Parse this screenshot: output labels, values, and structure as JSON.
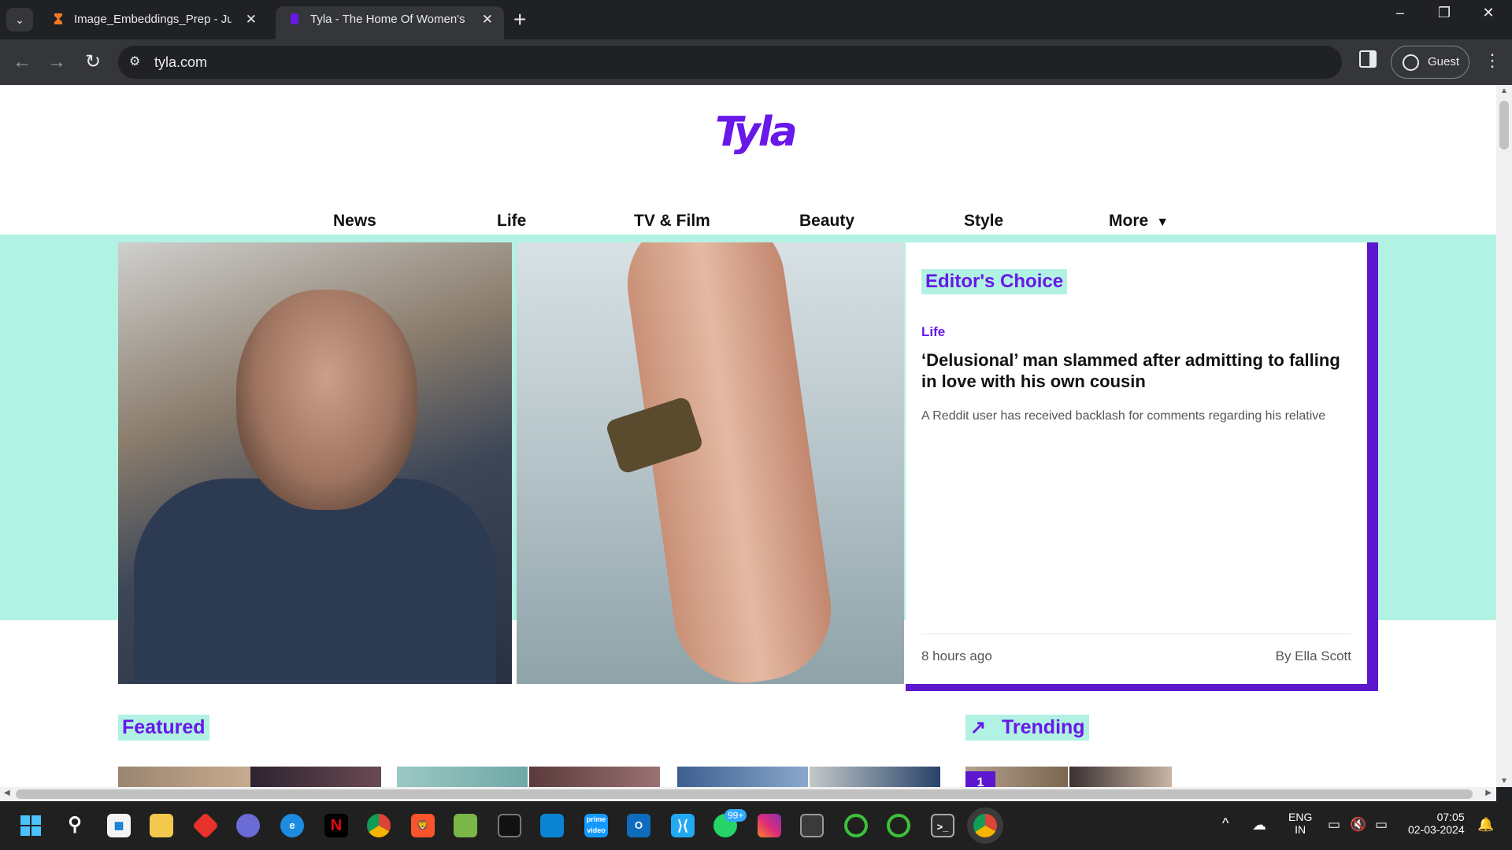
{
  "browser": {
    "tabs": [
      {
        "title": "Image_Embeddings_Prep - Jupyter",
        "favicon": "hourglass-icon",
        "active": false
      },
      {
        "title": "Tyla - The Home Of Women's News",
        "favicon": "tyla-icon",
        "active": true
      }
    ],
    "url": "tyla.com",
    "profile_label": "Guest"
  },
  "site": {
    "logo": "Tyla",
    "nav": [
      {
        "label": "News"
      },
      {
        "label": "Life"
      },
      {
        "label": "TV & Film"
      },
      {
        "label": "Beauty"
      },
      {
        "label": "Style"
      },
      {
        "label": "More"
      }
    ],
    "editors_choice": {
      "badge": "Editor's Choice",
      "category": "Life",
      "headline": "‘Delusional’ man slammed after admitting to falling in love with his own cousin",
      "standfirst": "A Reddit user has received backlash for comments regarding his relative",
      "time": "8 hours ago",
      "author": "By Ella Scott"
    },
    "featured_label": "Featured",
    "trending_label": "Trending",
    "trending_first_rank": "1"
  },
  "taskbar": {
    "lang_line1": "ENG",
    "lang_line2": "IN",
    "time": "07:05",
    "date": "02-03-2024",
    "whatsapp_badge": "99+"
  },
  "colors": {
    "brand_purple": "#6818e8",
    "mint": "#b1f2e3",
    "card_border": "#5d17cf"
  }
}
